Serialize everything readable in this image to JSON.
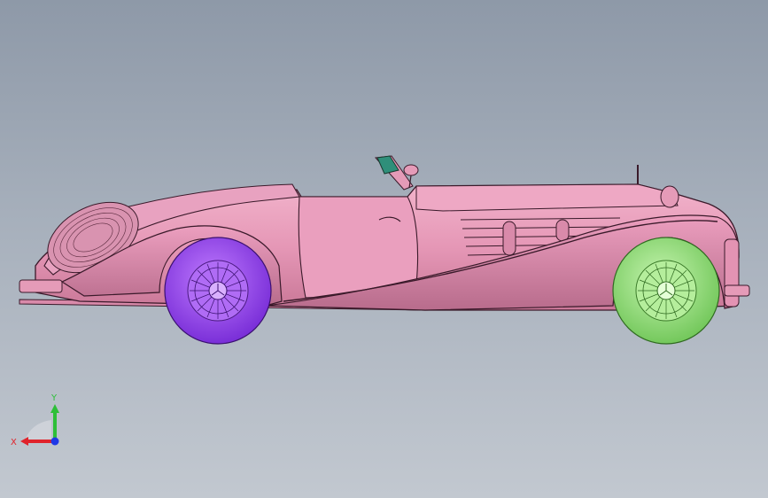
{
  "triad": {
    "x_label": "X",
    "y_label": "Y",
    "x_color": "#e0232b",
    "y_color": "#2dbf38",
    "z_color": "#1f38e6"
  },
  "model": {
    "body_color": "#e69ab8",
    "body_dark": "#b46c8a",
    "outline_color": "#3a1a2a",
    "front_tire_color": "#9b45f0",
    "rear_tire_color": "#95e27d",
    "windshield_color": "#2f8f7a"
  },
  "background": {
    "top": "#8e99a8",
    "bottom": "#c2c8d0"
  }
}
